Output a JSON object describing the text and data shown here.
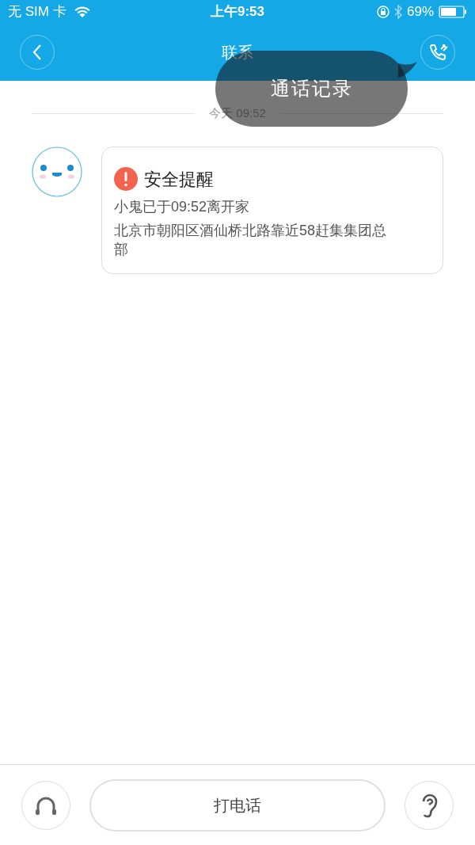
{
  "status_bar": {
    "carrier": "无 SIM 卡",
    "time": "上午9:53",
    "battery": "69%"
  },
  "nav": {
    "title": "联系"
  },
  "tooltip": {
    "text": "通话记录"
  },
  "timestamp": "今天 09:52",
  "messages": [
    {
      "title": "安全提醒",
      "lines": [
        "小鬼已于09:52离开家",
        "北京市朝阳区酒仙桥北路靠近58赶集集团总部"
      ]
    }
  ],
  "bottom_bar": {
    "call_button": "打电话"
  }
}
